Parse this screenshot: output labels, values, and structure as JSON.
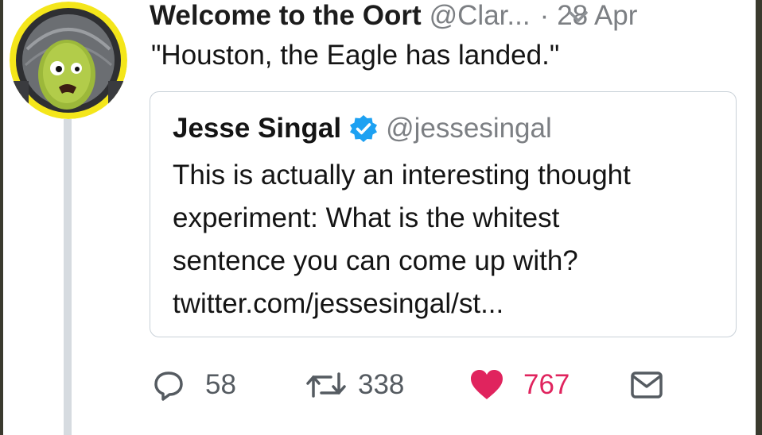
{
  "tweet": {
    "author_name": "Welcome to the Oort",
    "author_handle": "@Clar...",
    "separator": "·",
    "timestamp": "28 Apr",
    "text": "\"Houston, the Eagle has landed.\""
  },
  "quoted_tweet": {
    "author_name": "Jesse Singal",
    "author_handle": "@jessesingal",
    "lines": [
      "This is actually an interesting thought",
      "experiment: What is the whitest",
      "sentence you can come up with?",
      "twitter.com/jessesingal/st..."
    ]
  },
  "actions": {
    "replies": "58",
    "retweets": "338",
    "likes": "767"
  },
  "icons": {
    "avatar": "kerbal-astronaut-avatar",
    "caret": "chevron-down-icon",
    "verified": "verified-badge-icon",
    "reply": "reply-icon",
    "retweet": "retweet-icon",
    "like": "heart-icon",
    "dm": "envelope-icon"
  },
  "colors": {
    "like": "#e0245e",
    "verified": "#1da1f2",
    "muted_text": "#7c7f83",
    "avatar_ring": "#f4e61a"
  }
}
